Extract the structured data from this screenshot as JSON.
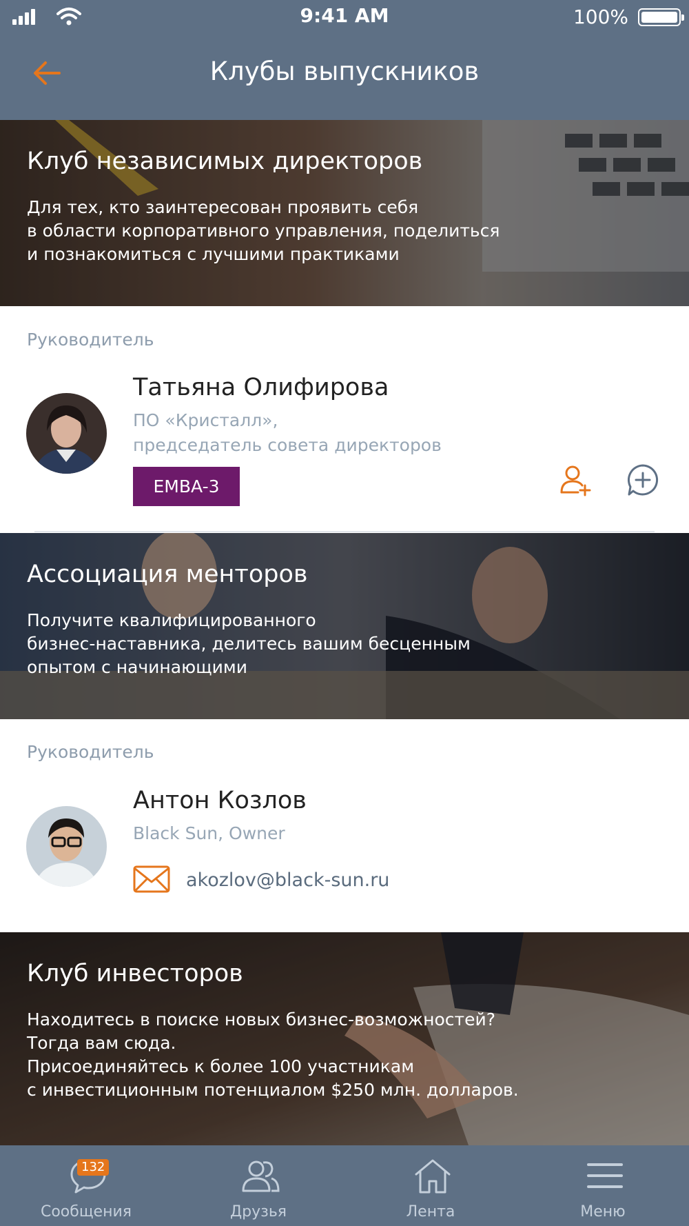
{
  "status_bar": {
    "time": "9:41 AM",
    "battery": "100%"
  },
  "nav": {
    "title": "Клубы выпускников"
  },
  "clubs": [
    {
      "title": "Клуб независимых директоров",
      "description": "Для тех, кто заинтересован проявить себя\nв области корпоративного управления, поделиться\nи познакомиться с лучшими практиками",
      "leader_label": "Руководитель",
      "leader": {
        "name": "Татьяна Олифирова",
        "position": "ПО «Кристалл»,\nпредседатель совета директоров",
        "badge": "EMBA-3"
      }
    },
    {
      "title": "Ассоциация менторов",
      "description": "Получите квалифицированного\nбизнес-наставника, делитесь вашим бесценным\nопытом с начинающими",
      "leader_label": "Руководитель",
      "leader": {
        "name": "Антон Козлов",
        "position": "Black Sun, Owner",
        "email": "akozlov@black-sun.ru"
      }
    },
    {
      "title": "Клуб инвесторов",
      "description": "Находитесь в поиске новых бизнес-возможностей?\nТогда вам сюда.\nПрисоединяйтесь к более 100 участникам\nс инвестиционным потенциалом $250 млн. долларов."
    }
  ],
  "tabbar": {
    "messages": {
      "label": "Сообщения",
      "badge": "132"
    },
    "friends": {
      "label": "Друзья"
    },
    "feed": {
      "label": "Лента"
    },
    "menu": {
      "label": "Меню"
    }
  },
  "colors": {
    "header": "#5e7085",
    "accent": "#e5761c",
    "badge": "#6d1a6a"
  }
}
